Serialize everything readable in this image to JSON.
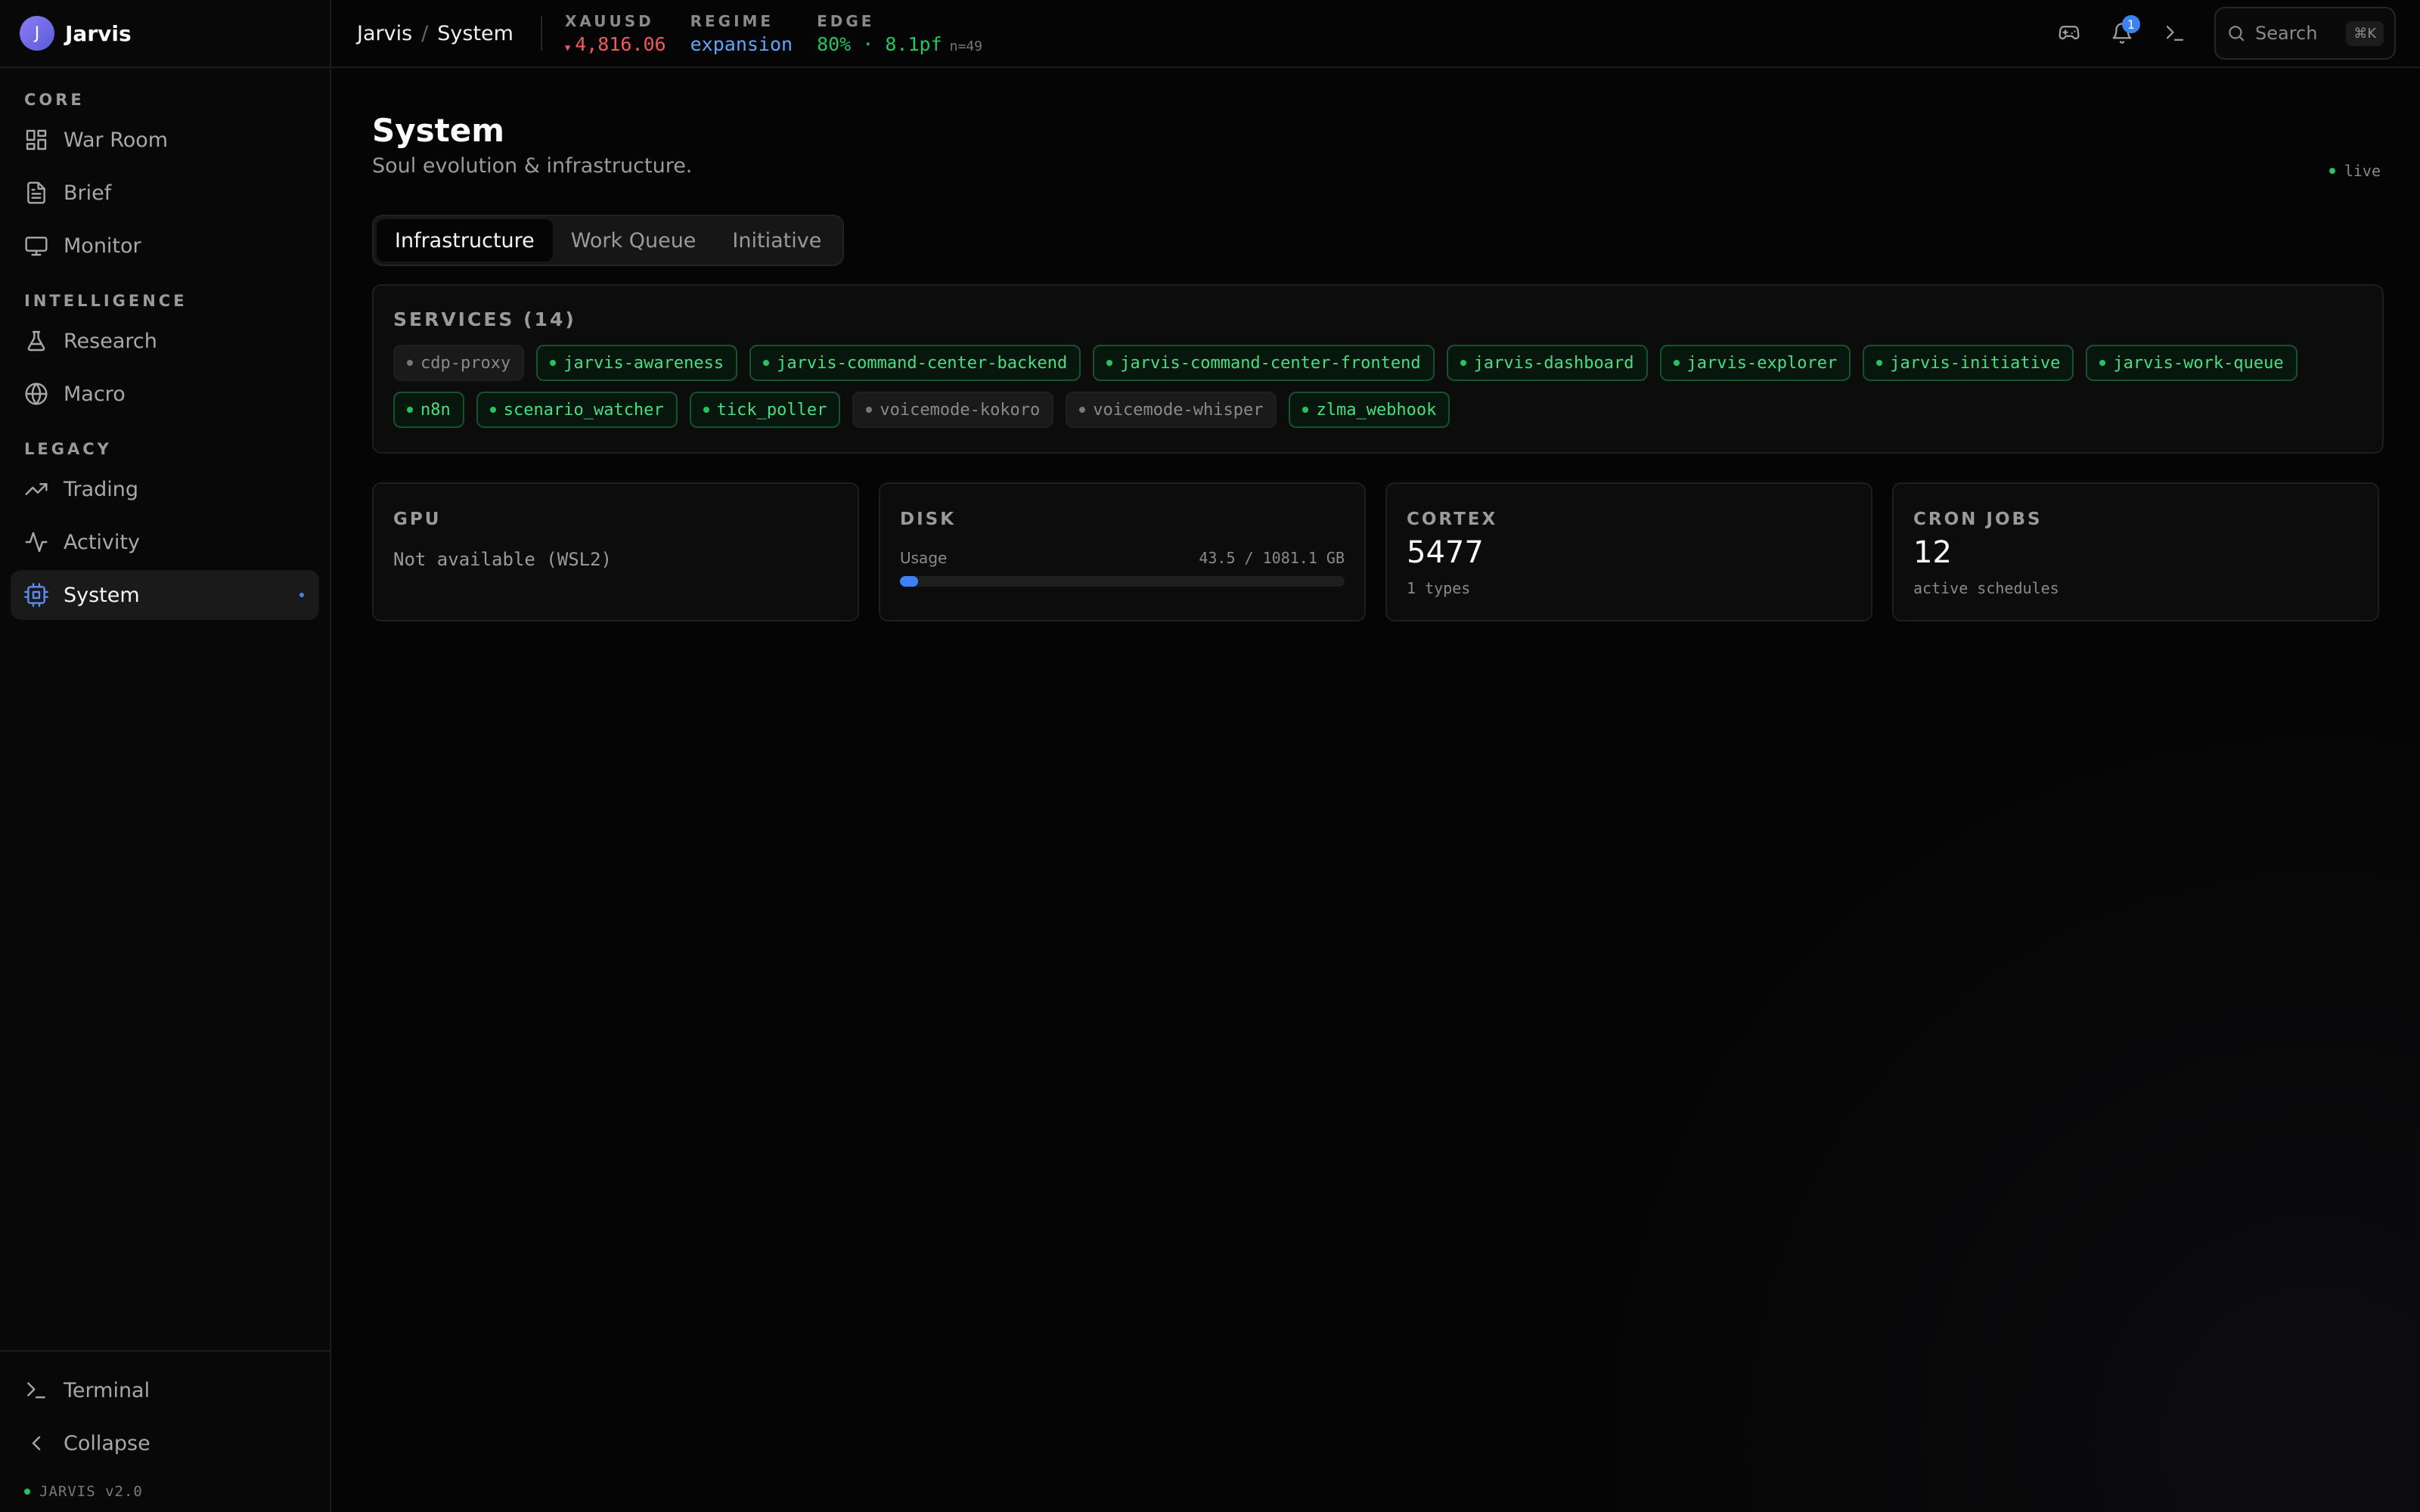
{
  "app": {
    "name": "Jarvis",
    "avatar_letter": "J",
    "accent": "#3b82f6",
    "brand_gradient": [
      "#8b7cf6",
      "#5b5bd6"
    ]
  },
  "sidebar": {
    "sections": [
      {
        "label": "CORE",
        "items": [
          {
            "label": "War Room",
            "icon": "grid-icon"
          },
          {
            "label": "Brief",
            "icon": "document-icon"
          },
          {
            "label": "Monitor",
            "icon": "monitor-icon"
          }
        ]
      },
      {
        "label": "INTELLIGENCE",
        "items": [
          {
            "label": "Research",
            "icon": "flask-icon"
          },
          {
            "label": "Macro",
            "icon": "globe-icon"
          }
        ]
      },
      {
        "label": "LEGACY",
        "items": [
          {
            "label": "Trading",
            "icon": "trending-up-icon"
          },
          {
            "label": "Activity",
            "icon": "activity-icon"
          },
          {
            "label": "System",
            "icon": "cpu-icon",
            "active": true
          }
        ]
      }
    ],
    "bottom": {
      "terminal": "Terminal",
      "collapse": "Collapse",
      "version": "JARVIS v2.0"
    }
  },
  "topbar": {
    "breadcrumb": [
      "Jarvis",
      "System"
    ],
    "metrics": {
      "xauusd": {
        "label": "XAUUSD",
        "value": "4,816.06",
        "color": "#ef5a5a"
      },
      "regime": {
        "label": "REGIME",
        "value": "expansion",
        "color": "#60a5fa"
      },
      "edge": {
        "label": "EDGE",
        "value": "80% · 8.1pf",
        "n": "n=49",
        "color": "#22c55e"
      }
    },
    "notification_count": "1",
    "search": {
      "placeholder": "Search",
      "shortcut": "⌘K"
    }
  },
  "page": {
    "title": "System",
    "subtitle": "Soul evolution & infrastructure.",
    "live": "live",
    "tabs": [
      "Infrastructure",
      "Work Queue",
      "Initiative"
    ],
    "active_tab": "Infrastructure"
  },
  "services": {
    "label": "SERVICES (14)",
    "items": [
      {
        "name": "cdp-proxy",
        "up": false
      },
      {
        "name": "jarvis-awareness",
        "up": true
      },
      {
        "name": "jarvis-command-center-backend",
        "up": true
      },
      {
        "name": "jarvis-command-center-frontend",
        "up": true
      },
      {
        "name": "jarvis-dashboard",
        "up": true
      },
      {
        "name": "jarvis-explorer",
        "up": true
      },
      {
        "name": "jarvis-initiative",
        "up": true
      },
      {
        "name": "jarvis-work-queue",
        "up": true
      },
      {
        "name": "n8n",
        "up": true
      },
      {
        "name": "scenario_watcher",
        "up": true
      },
      {
        "name": "tick_poller",
        "up": true
      },
      {
        "name": "voicemode-kokoro",
        "up": false
      },
      {
        "name": "voicemode-whisper",
        "up": false
      },
      {
        "name": "zlma_webhook",
        "up": true
      }
    ]
  },
  "stats": {
    "gpu": {
      "label": "GPU",
      "text": "Not available (WSL2)"
    },
    "disk": {
      "label": "DISK",
      "usage_label": "Usage",
      "usage_text": "43.5 / 1081.1 GB",
      "used": 43.5,
      "total": 1081.1
    },
    "cortex": {
      "label": "CORTEX",
      "value": "5477",
      "sub": "1 types"
    },
    "cron": {
      "label": "CRON JOBS",
      "value": "12",
      "sub": "active schedules"
    }
  }
}
